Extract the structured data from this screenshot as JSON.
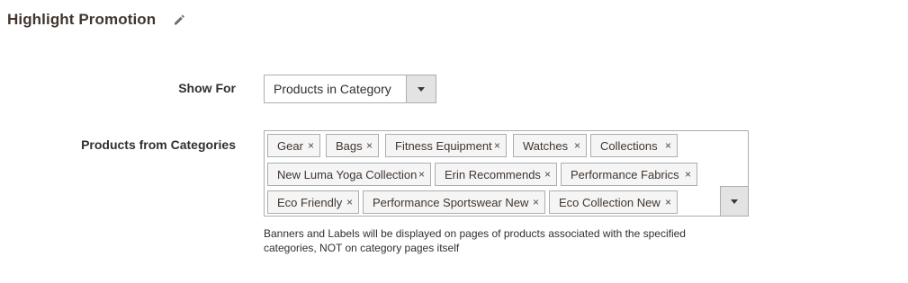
{
  "section": {
    "title": "Highlight Promotion",
    "edit_icon": "pencil-icon"
  },
  "show_for": {
    "label": "Show For",
    "value": "Products in Category",
    "arrow_icon": "triangle-down-icon"
  },
  "categories": {
    "label": "Products from Categories",
    "tags": [
      "Gear",
      "Bags",
      "Fitness Equipment",
      "Watches",
      "Collections",
      "New Luma Yoga Collection",
      "Erin Recommends",
      "Performance Fabrics",
      "Eco Friendly",
      "Performance Sportswear New",
      "Eco Collection New"
    ],
    "remove_glyph": "×",
    "arrow_icon": "triangle-down-icon",
    "note": "Banners and Labels will be displayed on pages of products associated with the specified categories, NOT on category pages itself"
  }
}
